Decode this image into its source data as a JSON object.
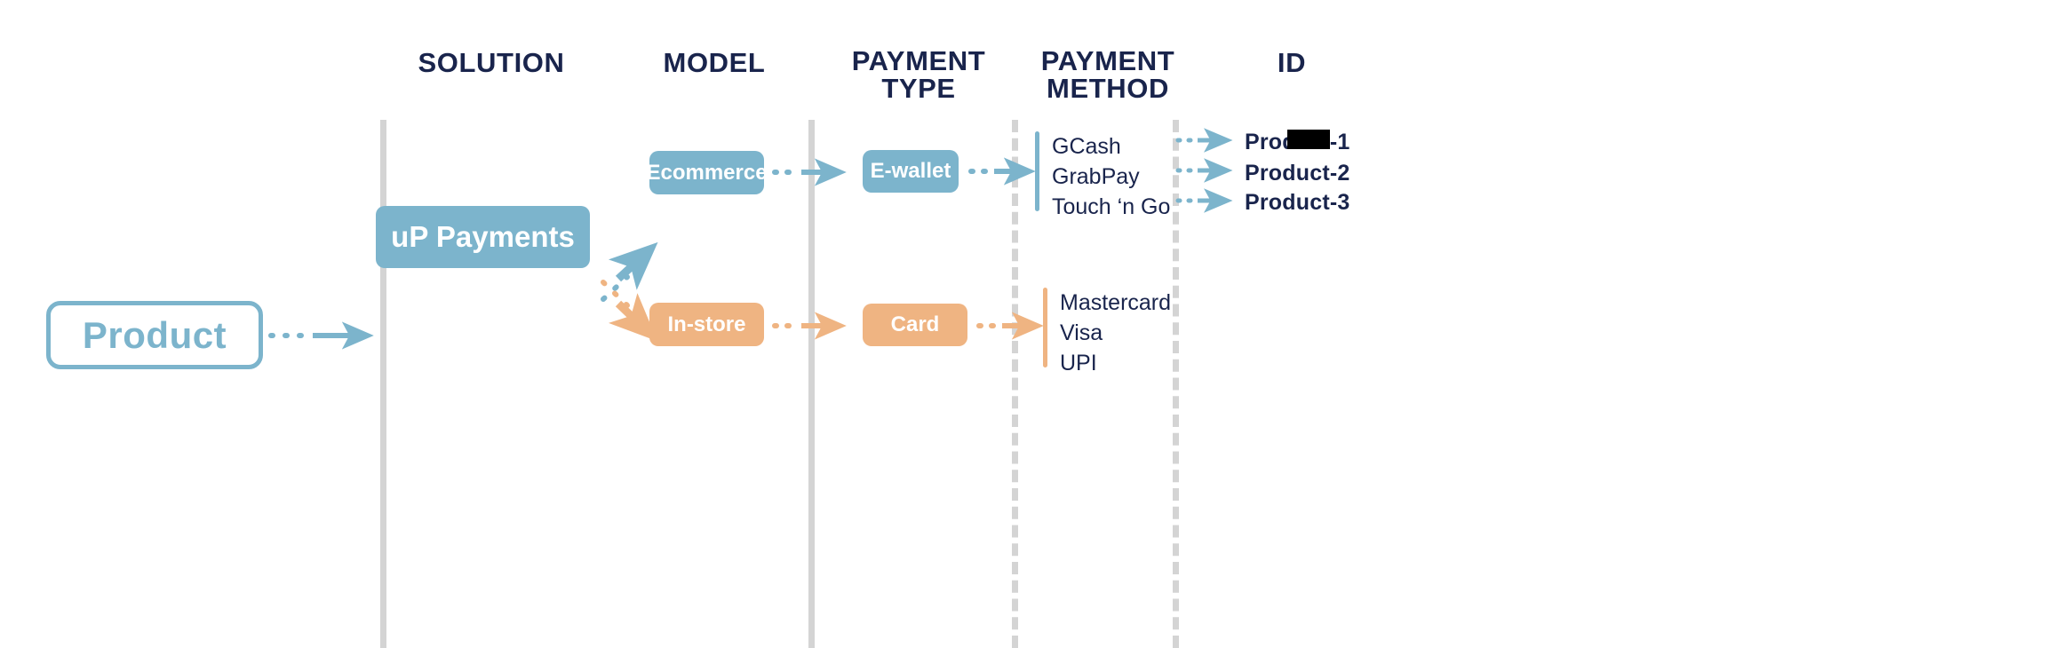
{
  "colors": {
    "blue": "#7cb4cc",
    "orange": "#efb482",
    "navy": "#19244c",
    "divider_gray": "#d4d4d4",
    "redaction": "#000000",
    "background": "#ffffff"
  },
  "headers": [
    {
      "label": "SOLUTION",
      "name": "header-solution"
    },
    {
      "label": "MODEL",
      "name": "header-model"
    },
    {
      "label": "PAYMENT\nTYPE",
      "name": "header-payment-type"
    },
    {
      "label": "PAYMENT\nMETHOD",
      "name": "header-payment-method"
    },
    {
      "label": "ID",
      "name": "header-id"
    }
  ],
  "product": {
    "label": "Product"
  },
  "solution": {
    "label": "uP Payments"
  },
  "models": {
    "ecommerce": "Ecommerce",
    "instore": "In-store"
  },
  "payment_types": {
    "ewallet": "E-wallet",
    "card": "Card"
  },
  "payment_methods": {
    "ewallet": [
      "GCash",
      "GrabPay",
      "Touch ‘n Go"
    ],
    "card": [
      "Mastercard",
      "Visa",
      "UPI"
    ]
  },
  "ids": [
    {
      "label": "Product-1",
      "redacted": true
    },
    {
      "label": "Product-2",
      "redacted": false
    },
    {
      "label": "Product-3",
      "redacted": false
    }
  ]
}
